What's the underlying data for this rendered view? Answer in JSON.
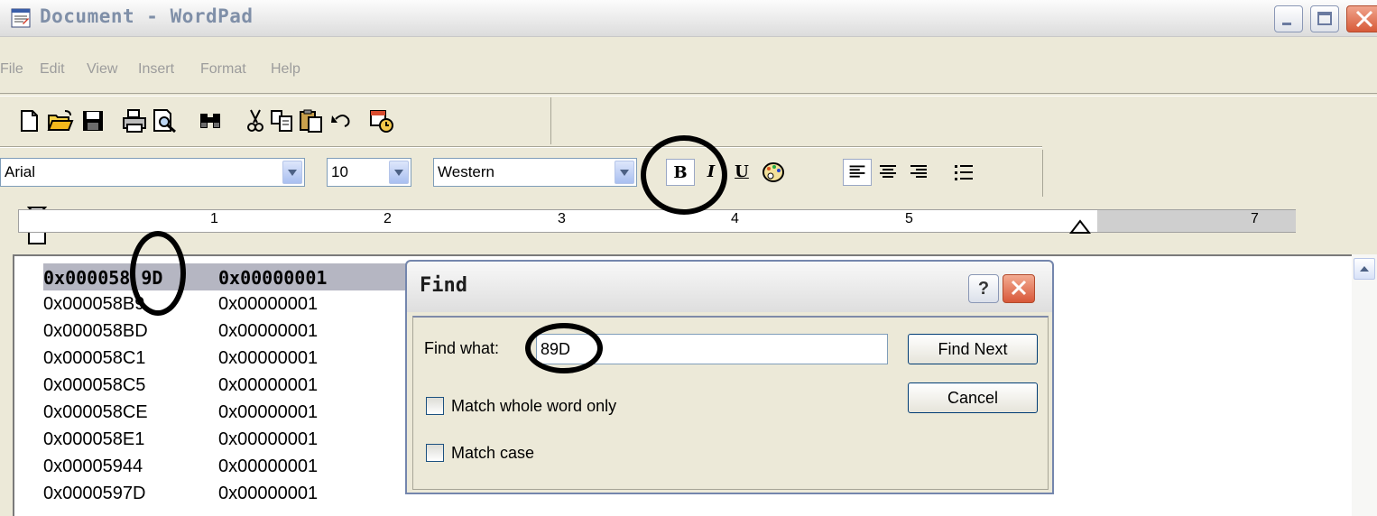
{
  "window": {
    "title": "Document - WordPad",
    "icon": "wordpad-app-icon"
  },
  "menu": [
    "File",
    "Edit",
    "View",
    "Insert",
    "Format",
    "Help"
  ],
  "toolbar": {
    "icons": [
      "new-document-icon",
      "open-folder-icon",
      "save-disk-icon",
      "print-icon",
      "print-preview-icon",
      "find-binoculars-icon",
      "cut-scissors-icon",
      "copy-icon",
      "paste-icon",
      "undo-icon",
      "date-time-icon"
    ]
  },
  "format_bar": {
    "font": "Arial",
    "size": "10",
    "script": "Western",
    "bold": "B",
    "italic": "I",
    "underline": "U"
  },
  "ruler": {
    "numbers": [
      "1",
      "2",
      "3",
      "4",
      "5",
      "7"
    ]
  },
  "document": {
    "rows": [
      {
        "address": "0x000058 9D",
        "value": "0x00000001"
      },
      {
        "address": "0x000058B9",
        "value": "0x00000001"
      },
      {
        "address": "0x000058BD",
        "value": "0x00000001"
      },
      {
        "address": "0x000058C1",
        "value": "0x00000001"
      },
      {
        "address": "0x000058C5",
        "value": "0x00000001"
      },
      {
        "address": "0x000058CE",
        "value": "0x00000001"
      },
      {
        "address": "0x000058E1",
        "value": "0x00000001"
      },
      {
        "address": "0x00005944",
        "value": "0x00000001"
      },
      {
        "address": "0x0000597D",
        "value": "0x00000001"
      }
    ]
  },
  "find_dialog": {
    "title": "Find",
    "help": "?",
    "find_what_label": "Find what:",
    "find_what_value": "89D",
    "find_next": "Find Next",
    "cancel": "Cancel",
    "match_whole_word": "Match whole word only",
    "match_case": "Match case"
  }
}
